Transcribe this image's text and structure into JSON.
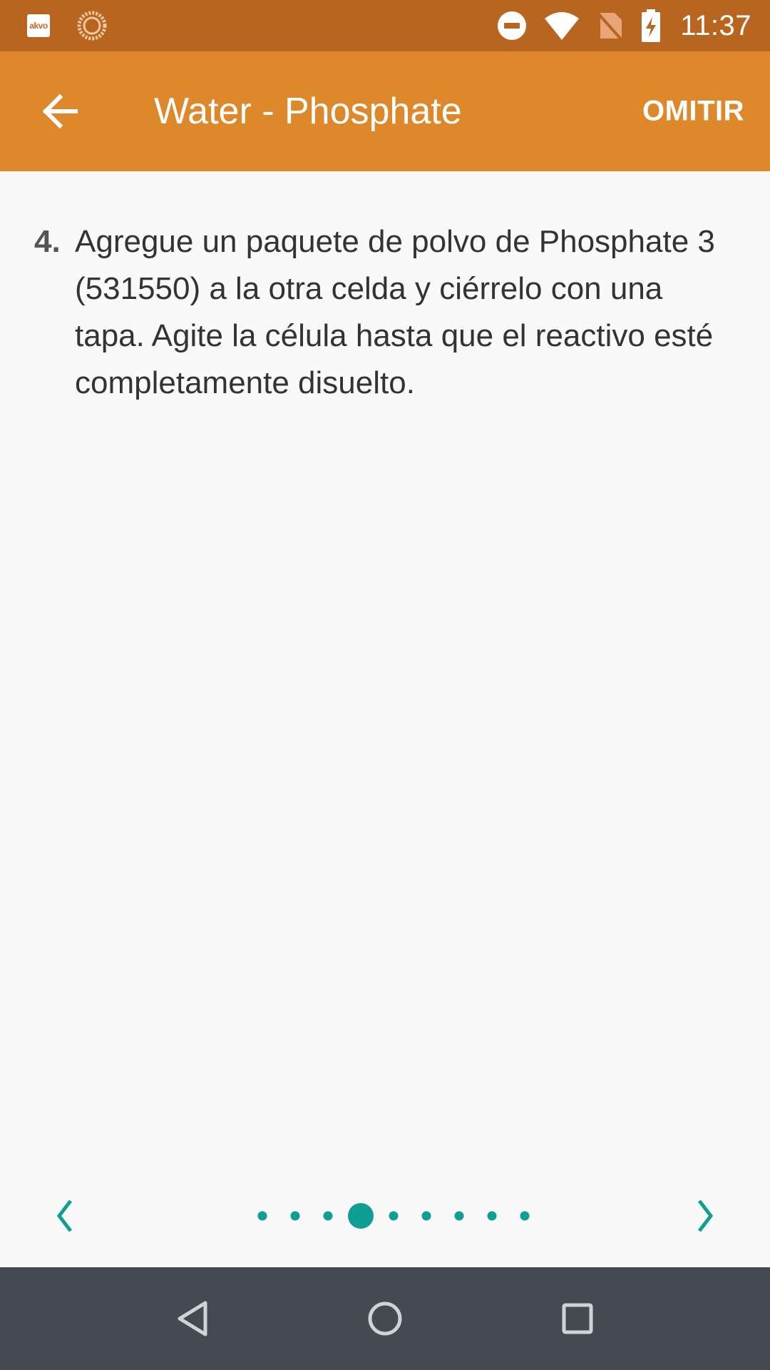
{
  "status_bar": {
    "app_icon_label": "akvo",
    "time": "11:37",
    "icons": [
      "akvo-app-icon",
      "sync-icon",
      "do-not-disturb-icon",
      "wifi-icon",
      "no-sim-icon",
      "battery-charging-icon"
    ]
  },
  "app_bar": {
    "title": "Water - Phosphate",
    "skip_label": "OMITIR",
    "back_icon": "arrow-back-icon"
  },
  "instruction": {
    "number": "4.",
    "text": "Agregue un paquete de polvo de Phosphate 3 (531550) a la otra celda y ciérrelo con una tapa. Agite la célula hasta que el reactivo esté completamente disuelto."
  },
  "pager": {
    "total_pages": 9,
    "current_page": 4,
    "prev_icon": "chevron-left-icon",
    "next_icon": "chevron-right-icon"
  },
  "colors": {
    "status_bar": "#b8651f",
    "app_bar": "#dd882b",
    "accent": "#0e9e93",
    "nav_bar": "#434a51"
  }
}
